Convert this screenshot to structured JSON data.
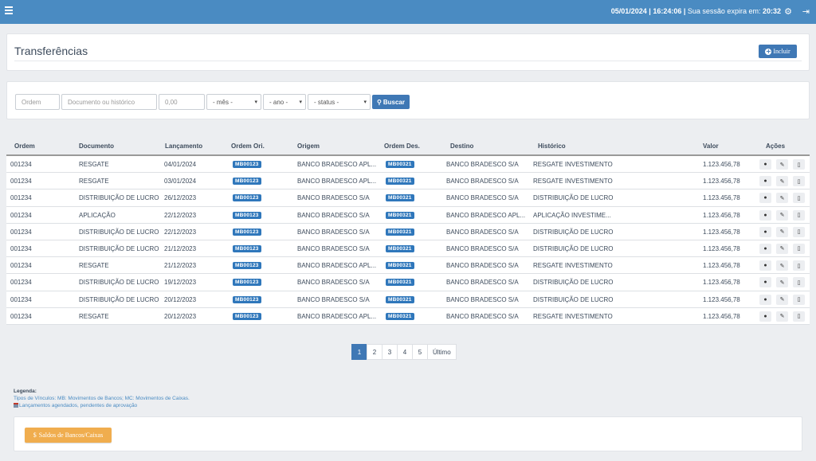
{
  "topbar": {
    "date": "05/01/2024",
    "sep1": "|",
    "time": "16:24:06",
    "sep2": "|",
    "session_label": "Sua sessão expira em:",
    "session_time": "20:32"
  },
  "page": {
    "title": "Transferências",
    "include_label": "Incluir"
  },
  "filters": {
    "ordem_placeholder": "Ordem",
    "documento_placeholder": "Documento ou histórico",
    "valor_placeholder": "0,00",
    "mes": "- mês -",
    "ano": "- ano -",
    "status": "- status -",
    "search_label": "Buscar"
  },
  "table": {
    "headers": [
      "Ordem",
      "Documento",
      "Lançamento",
      "Ordem Ori.",
      "Origem",
      "Ordem Des.",
      "Destino",
      "Histórico",
      "Valor",
      "Ações"
    ],
    "rows": [
      [
        "001234",
        "RESGATE",
        "04/01/2024",
        "MB00123",
        "BANCO BRADESCO APL...",
        "MB00321",
        "BANCO BRADESCO S/A",
        "RESGATE INVESTIMENTO",
        "1.123.456,78"
      ],
      [
        "001234",
        "RESGATE",
        "03/01/2024",
        "MB00123",
        "BANCO BRADESCO APL...",
        "MB00321",
        "BANCO BRADESCO S/A",
        "RESGATE INVESTIMENTO",
        "1.123.456,78"
      ],
      [
        "001234",
        "DISTRIBUIÇÃO DE LUCRO",
        "26/12/2023",
        "MB00123",
        "BANCO BRADESCO S/A",
        "MB00321",
        "BANCO BRADESCO S/A",
        "DISTRIBUIÇÃO DE LUCRO",
        "1.123.456,78"
      ],
      [
        "001234",
        "APLICAÇÃO",
        "22/12/2023",
        "MB00123",
        "BANCO BRADESCO S/A",
        "MB00321",
        "BANCO BRADESCO APL...",
        "APLICAÇÃO INVESTIME...",
        "1.123.456,78"
      ],
      [
        "001234",
        "DISTRIBUIÇÃO DE LUCRO",
        "22/12/2023",
        "MB00123",
        "BANCO BRADESCO S/A",
        "MB00321",
        "BANCO BRADESCO S/A",
        "DISTRIBUIÇÃO DE LUCRO",
        "1.123.456,78"
      ],
      [
        "001234",
        "DISTRIBUIÇÃO DE LUCRO",
        "21/12/2023",
        "MB00123",
        "BANCO BRADESCO S/A",
        "MB00321",
        "BANCO BRADESCO S/A",
        "DISTRIBUIÇÃO DE LUCRO",
        "1.123.456,78"
      ],
      [
        "001234",
        "RESGATE",
        "21/12/2023",
        "MB00123",
        "BANCO BRADESCO APL...",
        "MB00321",
        "BANCO BRADESCO S/A",
        "RESGATE INVESTIMENTO",
        "1.123.456,78"
      ],
      [
        "001234",
        "DISTRIBUIÇÃO DE LUCRO",
        "19/12/2023",
        "MB00123",
        "BANCO BRADESCO S/A",
        "MB00321",
        "BANCO BRADESCO S/A",
        "DISTRIBUIÇÃO DE LUCRO",
        "1.123.456,78"
      ],
      [
        "001234",
        "DISTRIBUIÇÃO DE LUCRO",
        "20/12/2023",
        "MB00123",
        "BANCO BRADESCO S/A",
        "MB00321",
        "BANCO BRADESCO S/A",
        "DISTRIBUIÇÃO DE LUCRO",
        "1.123.456,78"
      ],
      [
        "001234",
        "RESGATE",
        "20/12/2023",
        "MB00123",
        "BANCO BRADESCO APL...",
        "MB00321",
        "BANCO BRADESCO S/A",
        "RESGATE INVESTIMENTO",
        "1.123.456,78"
      ]
    ],
    "row_actions": [
      "eye-icon",
      "pencil-icon",
      "trash-icon"
    ]
  },
  "pagination": {
    "pages": [
      "1",
      "2",
      "3",
      "4",
      "5"
    ],
    "last": "Último",
    "current": "1"
  },
  "legend": {
    "title": "Legenda:",
    "vinculos": "Tipos de Vínculos: MB: Movimentos de Bancos; MC: Movimentos de Caixas.",
    "agendados": "Lançamentos agendados, pendentes de aprovação"
  },
  "saldos": {
    "label": "Saldos de Bancos/Caixas"
  },
  "colors": {
    "topbar": "#4a8bc2",
    "primary": "#3f78b5",
    "badge": "#2f77bb",
    "warning": "#f0ad4e"
  }
}
